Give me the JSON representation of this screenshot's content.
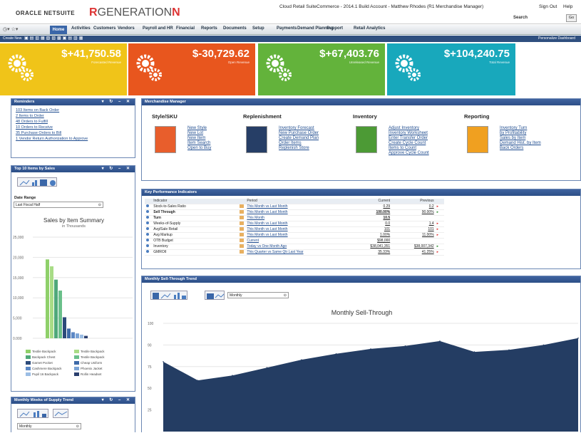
{
  "header": {
    "oracle": "ORACLE NETSUITE",
    "gen_prefix": "R",
    "gen_main": "GENERATION",
    "gen_suffix": "N",
    "account": "Cloud Retail SuiteCommerce - 2014.1 Build Account - Matthew Rhodes (R1 Merchandise Manager)",
    "signout": "Sign Out",
    "help": "Help",
    "search_label": "Search",
    "go": "Go"
  },
  "nav": {
    "home": "Home",
    "items": [
      "Activities",
      "Customers",
      "Vendors",
      "Payroll and HR",
      "Financial",
      "Reports",
      "Documents",
      "Setup",
      "Payments",
      "Demand Planning",
      "Support",
      "Retail Analytics"
    ]
  },
  "shortcuts": {
    "label": "Create New",
    "personalize": "Personalize Dashboard"
  },
  "tiles": [
    {
      "value": "$+41,750.58",
      "sub": "Forecasted Revenue",
      "color": "#f0c419"
    },
    {
      "value": "$-30,729.62",
      "sub": "Open Revenue",
      "color": "#e8561e"
    },
    {
      "value": "$+67,403.76",
      "sub": "Unreleased Revenue",
      "color": "#63b33b"
    },
    {
      "value": "$+104,240.75",
      "sub": "Total Revenue",
      "color": "#18a8bc"
    }
  ],
  "reminders": {
    "title": "Reminders",
    "items": [
      "103 Items on Back Order",
      "2 Items to Order",
      "48 Orders to Fulfill",
      "10 Orders to Receive",
      "35 Purchase Orders to Bill",
      "1 Vendor Return Authorization to Approve"
    ]
  },
  "top_items": {
    "title": "Top 10 Items by Sales",
    "date_range_label": "Date Range",
    "date_range_value": "Last Fiscal Half",
    "chart_title": "Sales by Item Summary",
    "chart_subtitle": "in Thousands"
  },
  "weeks_supply": {
    "title": "Monthly Weeks of Supply Trend",
    "select": "Monthly"
  },
  "merch": {
    "title": "Merchandise Manager",
    "sections": [
      {
        "heading": "Style/SKU",
        "links": [
          "New Style",
          "New Lot",
          "New Item",
          "Item Search",
          "Open to Buy"
        ]
      },
      {
        "heading": "Replenishment",
        "links": [
          "Inventory Forecast",
          "New Purchase Order",
          "Create Demand Plan",
          "Order Items",
          "Replenish Store"
        ]
      },
      {
        "heading": "Inventory",
        "links": [
          "Adjust Inventory",
          "Inventory Worksheet",
          "Enter Transfer Order",
          "Create Cycle Count",
          "Items to Count",
          "Approve Cycle Count"
        ]
      },
      {
        "heading": "Reporting",
        "links": [
          "Inventory Turn",
          "by Profitability",
          "Sales by Item",
          "Demand Hist. by Item",
          "Back Orders"
        ]
      }
    ]
  },
  "kpi": {
    "title": "Key Performance Indicators",
    "headers": [
      "Indicator",
      "Period",
      "Current",
      "Previous"
    ],
    "rows": [
      {
        "indicator": "Stock-to-Sales Ratio",
        "period": "This Month vs Last Month",
        "current": "0.29",
        "previous": "0.2",
        "bold": false,
        "trend": "r"
      },
      {
        "indicator": "Sell Through",
        "period": "This Month vs Last Month",
        "current": "100.00%",
        "previous": "90.00%",
        "bold": true,
        "trend": "g"
      },
      {
        "indicator": "Turn",
        "period": "This Month",
        "current": "10.5",
        "previous": "",
        "bold": true,
        "trend": ""
      },
      {
        "indicator": "Weeks-of-Supply",
        "period": "This Month vs Last Month",
        "current": "0.0",
        "previous": "1.4",
        "bold": false,
        "trend": "r"
      },
      {
        "indicator": "Avg/Sale Retail",
        "period": "This Month vs Last Month",
        "current": "101",
        "previous": "101",
        "bold": false,
        "trend": "r"
      },
      {
        "indicator": "Avg Markup",
        "period": "This Month vs Last Month",
        "current": "1.00%",
        "previous": "11.00%",
        "bold": false,
        "trend": "r"
      },
      {
        "indicator": "OTB Budget",
        "period": "Current",
        "current": "$98,000",
        "previous": "",
        "bold": false,
        "trend": ""
      },
      {
        "indicator": "Inventory",
        "period": "Today vs One Month Ago",
        "current": "$38,041,351",
        "previous": "$38,007,342",
        "bold": false,
        "trend": "g"
      },
      {
        "indicator": "GMROII",
        "period": "This Quarter vs Same Qtr Last Year",
        "current": "35.33%",
        "previous": "41.25%",
        "bold": false,
        "trend": "r"
      }
    ]
  },
  "sell_through": {
    "title": "Monthly Sell-Through Trend",
    "select": "Monthly",
    "chart_title": "Monthly Sell-Through"
  },
  "chart_data": [
    {
      "type": "bar",
      "title": "Sales by Item Summary",
      "subtitle": "in Thousands",
      "yticks": [
        "25,000",
        "20,000",
        "15,000",
        "10,000",
        "5,000",
        "0.000"
      ],
      "ylim": [
        0,
        25000
      ],
      "values": [
        19500,
        17800,
        14500,
        11800,
        5200,
        2400,
        1500,
        1200,
        900,
        600
      ],
      "colors": [
        "#8fd06a",
        "#a8dc86",
        "#4fa87a",
        "#6abf8a",
        "#2c4a7a",
        "#3e6aa8",
        "#5b87c4",
        "#7aa3d6",
        "#9bbde4",
        "#2a3f6e"
      ],
      "legend": [
        "Textile Backpack",
        "Textile Backpack",
        "Backpack Chest",
        "Textile Backpack",
        "Garnet Pocket",
        "Cheap Uniform",
        "Cashmere Backpack",
        "Phoenix Jacket",
        "Pupil 16 Backpack",
        "Rollin Headset"
      ]
    },
    {
      "type": "area",
      "title": "Monthly Sell-Through",
      "yticks": [
        "100",
        "90",
        "75",
        "50",
        "25"
      ],
      "ylim": [
        0,
        110
      ],
      "values": [
        71,
        52,
        57,
        65,
        73,
        79,
        84,
        87,
        92,
        81,
        83,
        88,
        95
      ],
      "color": "#243d63"
    }
  ]
}
